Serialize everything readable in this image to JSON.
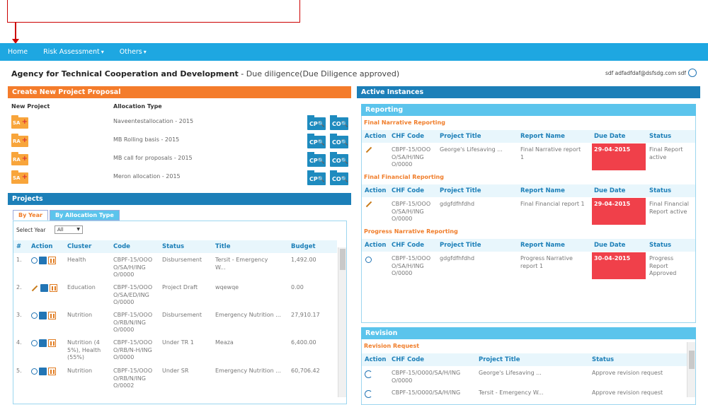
{
  "nav": {
    "home": "Home",
    "risk": "Risk Assessment",
    "others": "Others"
  },
  "header": {
    "org": "Agency for Technical Cooperation and Development",
    "sep": " - ",
    "status": "Due diligence(Due Diligence approved)",
    "user": "sdf adfadfdaf@dsfsdg.com sdf"
  },
  "proposal": {
    "title": "Create New Project Proposal",
    "col_new": "New Project",
    "col_alloc": "Allocation Type",
    "rows": [
      {
        "badge": "SA",
        "name": "Naveentestallocation - 2015"
      },
      {
        "badge": "RA",
        "name": "MB Rolling basis - 2015"
      },
      {
        "badge": "RA",
        "name": "MB call for proposals - 2015"
      },
      {
        "badge": "SA",
        "name": "Meron allocation - 2015"
      }
    ],
    "cp": "CP",
    "co": "CO"
  },
  "projects": {
    "title": "Projects",
    "tab_year": "By Year",
    "tab_alloc": "By Allocation Type",
    "select_label": "Select Year",
    "select_value": "All",
    "headers": [
      "#",
      "Action",
      "Cluster",
      "Code",
      "Status",
      "Title",
      "Budget"
    ],
    "rows": [
      {
        "n": "1.",
        "cluster": "Health",
        "code": "CBPF-15/OOO\nO/SA/H/ING\nO/0000",
        "status": "Disbursement",
        "title": "Tersit - Emergency\nW...",
        "budget": "1,492.00"
      },
      {
        "n": "2.",
        "cluster": "Education",
        "code": "CBPF-15/OOO\nO/SA/ED/ING\nO/0000",
        "status": "Project Draft",
        "title": "wqewqe",
        "budget": "0.00"
      },
      {
        "n": "3.",
        "cluster": "Nutrition",
        "code": "CBPF-15/OOO\nO/RB/N/ING\nO/0000",
        "status": "Disbursement",
        "title": "Emergency Nutrition ...",
        "budget": "27,910.17"
      },
      {
        "n": "4.",
        "cluster": "Nutrition (4\n5%), Health\n(55%)",
        "code": "CBPF-15/OOO\nO/RB/N-H/ING\nO/0000",
        "status": "Under TR 1",
        "title": "Meaza",
        "budget": "6,400.00"
      },
      {
        "n": "5.",
        "cluster": "Nutrition",
        "code": "CBPF-15/OOO\nO/RB/N/ING\nO/0002",
        "status": "Under SR",
        "title": "Emergency Nutrition ...",
        "budget": "60,706.42"
      }
    ]
  },
  "active": {
    "title": "Active Instances",
    "reporting_title": "Reporting",
    "headers": [
      "Action",
      "CHF Code",
      "Project Title",
      "Report Name",
      "Due Date",
      "Status"
    ],
    "sections": [
      {
        "label": "Final Narrative Reporting",
        "code": "CBPF-15/OOO\nO/SA/H/ING\nO/0000",
        "project": "George's Lifesaving ...",
        "report": "Final Narrative report\n1",
        "due": "29-04-2015",
        "status": "Final Report\nactive"
      },
      {
        "label": "Final Financial Reporting",
        "code": "CBPF-15/OOO\nO/SA/H/ING\nO/0000",
        "project": "gdgfdfhfdhd",
        "report": "Final Financial report 1",
        "due": "29-04-2015",
        "status": "Final Financial\nReport active"
      },
      {
        "label": "Progress Narrative Reporting",
        "code": "CBPF-15/OOO\nO/SA/H/ING\nO/0000",
        "project": "gdgfdfhfdhd",
        "report": "Progress Narrative\nreport 1",
        "due": "30-04-2015",
        "status": "Progress\nReport\nApproved"
      }
    ],
    "revision_title": "Revision",
    "revision_request": "Revision Request",
    "rev_headers": [
      "Action",
      "CHF Code",
      "Project Title",
      "Status"
    ],
    "rev_rows": [
      {
        "code": "CBPF-15/O000/SA/H/ING\nO/0000",
        "project": "George's Lifesaving ...",
        "status": "Approve revision request"
      },
      {
        "code": "CBPF-15/O000/SA/H/ING",
        "project": "Tersit - Emergency W...",
        "status": "Approve revision request"
      }
    ]
  }
}
